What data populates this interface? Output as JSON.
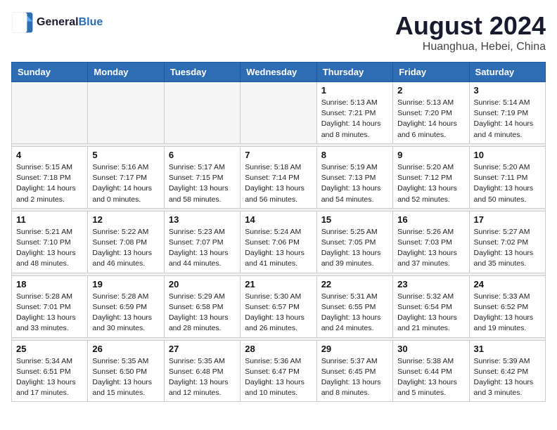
{
  "logo": {
    "line1": "General",
    "line2": "Blue"
  },
  "title": "August 2024",
  "location": "Huanghua, Hebei, China",
  "days_of_week": [
    "Sunday",
    "Monday",
    "Tuesday",
    "Wednesday",
    "Thursday",
    "Friday",
    "Saturday"
  ],
  "weeks": [
    [
      {
        "day": "",
        "info": ""
      },
      {
        "day": "",
        "info": ""
      },
      {
        "day": "",
        "info": ""
      },
      {
        "day": "",
        "info": ""
      },
      {
        "day": "1",
        "info": "Sunrise: 5:13 AM\nSunset: 7:21 PM\nDaylight: 14 hours\nand 8 minutes."
      },
      {
        "day": "2",
        "info": "Sunrise: 5:13 AM\nSunset: 7:20 PM\nDaylight: 14 hours\nand 6 minutes."
      },
      {
        "day": "3",
        "info": "Sunrise: 5:14 AM\nSunset: 7:19 PM\nDaylight: 14 hours\nand 4 minutes."
      }
    ],
    [
      {
        "day": "4",
        "info": "Sunrise: 5:15 AM\nSunset: 7:18 PM\nDaylight: 14 hours\nand 2 minutes."
      },
      {
        "day": "5",
        "info": "Sunrise: 5:16 AM\nSunset: 7:17 PM\nDaylight: 14 hours\nand 0 minutes."
      },
      {
        "day": "6",
        "info": "Sunrise: 5:17 AM\nSunset: 7:15 PM\nDaylight: 13 hours\nand 58 minutes."
      },
      {
        "day": "7",
        "info": "Sunrise: 5:18 AM\nSunset: 7:14 PM\nDaylight: 13 hours\nand 56 minutes."
      },
      {
        "day": "8",
        "info": "Sunrise: 5:19 AM\nSunset: 7:13 PM\nDaylight: 13 hours\nand 54 minutes."
      },
      {
        "day": "9",
        "info": "Sunrise: 5:20 AM\nSunset: 7:12 PM\nDaylight: 13 hours\nand 52 minutes."
      },
      {
        "day": "10",
        "info": "Sunrise: 5:20 AM\nSunset: 7:11 PM\nDaylight: 13 hours\nand 50 minutes."
      }
    ],
    [
      {
        "day": "11",
        "info": "Sunrise: 5:21 AM\nSunset: 7:10 PM\nDaylight: 13 hours\nand 48 minutes."
      },
      {
        "day": "12",
        "info": "Sunrise: 5:22 AM\nSunset: 7:08 PM\nDaylight: 13 hours\nand 46 minutes."
      },
      {
        "day": "13",
        "info": "Sunrise: 5:23 AM\nSunset: 7:07 PM\nDaylight: 13 hours\nand 44 minutes."
      },
      {
        "day": "14",
        "info": "Sunrise: 5:24 AM\nSunset: 7:06 PM\nDaylight: 13 hours\nand 41 minutes."
      },
      {
        "day": "15",
        "info": "Sunrise: 5:25 AM\nSunset: 7:05 PM\nDaylight: 13 hours\nand 39 minutes."
      },
      {
        "day": "16",
        "info": "Sunrise: 5:26 AM\nSunset: 7:03 PM\nDaylight: 13 hours\nand 37 minutes."
      },
      {
        "day": "17",
        "info": "Sunrise: 5:27 AM\nSunset: 7:02 PM\nDaylight: 13 hours\nand 35 minutes."
      }
    ],
    [
      {
        "day": "18",
        "info": "Sunrise: 5:28 AM\nSunset: 7:01 PM\nDaylight: 13 hours\nand 33 minutes."
      },
      {
        "day": "19",
        "info": "Sunrise: 5:28 AM\nSunset: 6:59 PM\nDaylight: 13 hours\nand 30 minutes."
      },
      {
        "day": "20",
        "info": "Sunrise: 5:29 AM\nSunset: 6:58 PM\nDaylight: 13 hours\nand 28 minutes."
      },
      {
        "day": "21",
        "info": "Sunrise: 5:30 AM\nSunset: 6:57 PM\nDaylight: 13 hours\nand 26 minutes."
      },
      {
        "day": "22",
        "info": "Sunrise: 5:31 AM\nSunset: 6:55 PM\nDaylight: 13 hours\nand 24 minutes."
      },
      {
        "day": "23",
        "info": "Sunrise: 5:32 AM\nSunset: 6:54 PM\nDaylight: 13 hours\nand 21 minutes."
      },
      {
        "day": "24",
        "info": "Sunrise: 5:33 AM\nSunset: 6:52 PM\nDaylight: 13 hours\nand 19 minutes."
      }
    ],
    [
      {
        "day": "25",
        "info": "Sunrise: 5:34 AM\nSunset: 6:51 PM\nDaylight: 13 hours\nand 17 minutes."
      },
      {
        "day": "26",
        "info": "Sunrise: 5:35 AM\nSunset: 6:50 PM\nDaylight: 13 hours\nand 15 minutes."
      },
      {
        "day": "27",
        "info": "Sunrise: 5:35 AM\nSunset: 6:48 PM\nDaylight: 13 hours\nand 12 minutes."
      },
      {
        "day": "28",
        "info": "Sunrise: 5:36 AM\nSunset: 6:47 PM\nDaylight: 13 hours\nand 10 minutes."
      },
      {
        "day": "29",
        "info": "Sunrise: 5:37 AM\nSunset: 6:45 PM\nDaylight: 13 hours\nand 8 minutes."
      },
      {
        "day": "30",
        "info": "Sunrise: 5:38 AM\nSunset: 6:44 PM\nDaylight: 13 hours\nand 5 minutes."
      },
      {
        "day": "31",
        "info": "Sunrise: 5:39 AM\nSunset: 6:42 PM\nDaylight: 13 hours\nand 3 minutes."
      }
    ]
  ]
}
